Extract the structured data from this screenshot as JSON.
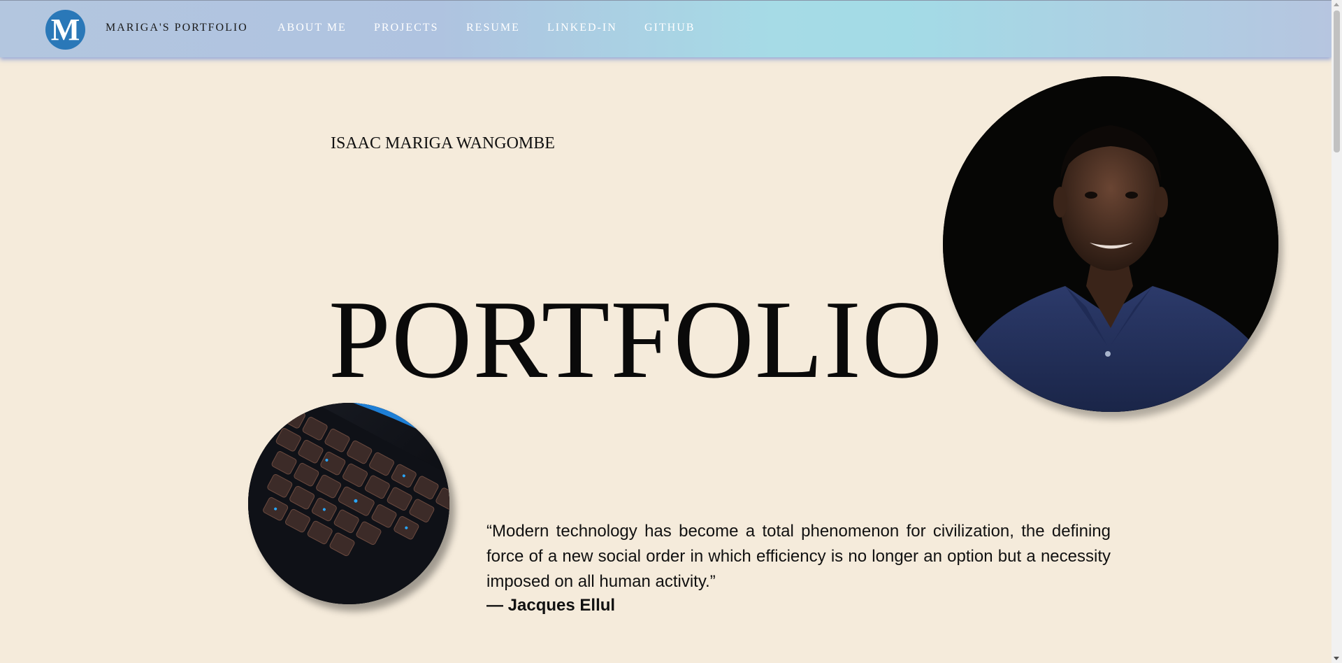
{
  "navbar": {
    "logo_letter": "M",
    "brand": "MARIGA'S PORTFOLIO",
    "links": [
      "ABOUT ME",
      "PROJECTS",
      "RESUME",
      "LINKED-IN",
      "GITHUB"
    ]
  },
  "hero": {
    "name": "ISAAC MARIGA WANGOMBE",
    "title": "PORTFOLIO"
  },
  "quote": {
    "text": "“Modern technology has become a total phenomenon for civilization, the defining force of a new social order in which efficiency is no longer an option but a necessity imposed on all human activity.”",
    "author": "— Jacques Ellul"
  },
  "colors": {
    "background": "#f5ebdb",
    "logo": "#2a78b8",
    "nav_text": "#ffffff"
  }
}
